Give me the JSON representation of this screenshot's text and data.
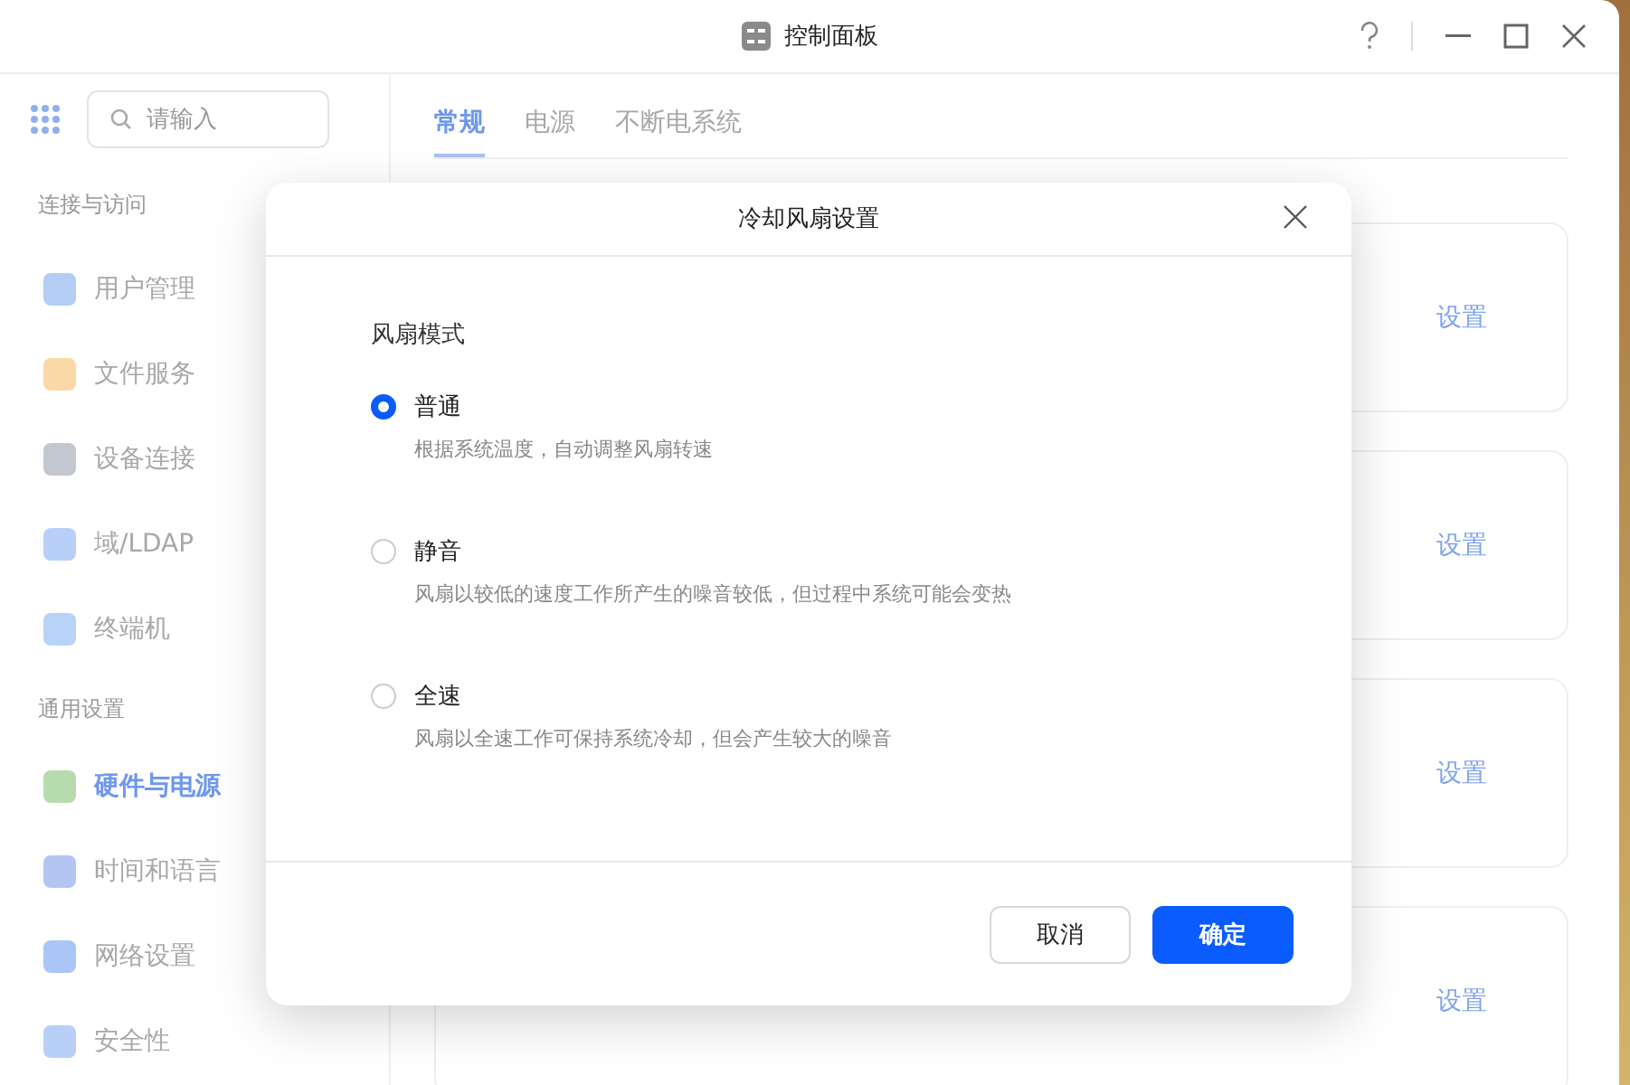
{
  "window": {
    "title": "控制面板"
  },
  "sidebar": {
    "search": {
      "placeholder": "请输入"
    },
    "sections": [
      {
        "heading": "连接与访问",
        "items": [
          {
            "label": "用户管理",
            "selected": false,
            "color": "#b3cdf5"
          },
          {
            "label": "文件服务",
            "selected": false,
            "color": "#fad9a6"
          },
          {
            "label": "设备连接",
            "selected": false,
            "color": "#c3c7cf"
          },
          {
            "label": "域/LDAP",
            "selected": false,
            "color": "#b8cff7"
          },
          {
            "label": "终端机",
            "selected": false,
            "color": "#b8d3f7"
          }
        ]
      },
      {
        "heading": "通用设置",
        "items": [
          {
            "label": "硬件与电源",
            "selected": true,
            "color": "#b6dcae"
          },
          {
            "label": "时间和语言",
            "selected": false,
            "color": "#b3c6f3"
          },
          {
            "label": "网络设置",
            "selected": false,
            "color": "#aac6f7"
          },
          {
            "label": "安全性",
            "selected": false,
            "color": "#b8cff7"
          }
        ]
      }
    ]
  },
  "tabs": [
    {
      "label": "常规",
      "selected": true
    },
    {
      "label": "电源",
      "selected": false
    },
    {
      "label": "不断电系统",
      "selected": false
    }
  ],
  "cards": [
    {
      "action": "设置"
    },
    {
      "action": "设置"
    },
    {
      "action": "设置"
    },
    {
      "action": "设置"
    }
  ],
  "dialog": {
    "title": "冷却风扇设置",
    "group_label": "风扇模式",
    "options": [
      {
        "label": "普通",
        "description": "根据系统温度，自动调整风扇转速",
        "selected": true
      },
      {
        "label": "静音",
        "description": "风扇以较低的速度工作所产生的噪音较低，但过程中系统可能会变热",
        "selected": false
      },
      {
        "label": "全速",
        "description": "风扇以全速工作可保持系统冷却，但会产生较大的噪音",
        "selected": false
      }
    ],
    "buttons": [
      {
        "label": "取消",
        "kind": "secondary"
      },
      {
        "label": "确定",
        "kind": "primary"
      }
    ]
  }
}
